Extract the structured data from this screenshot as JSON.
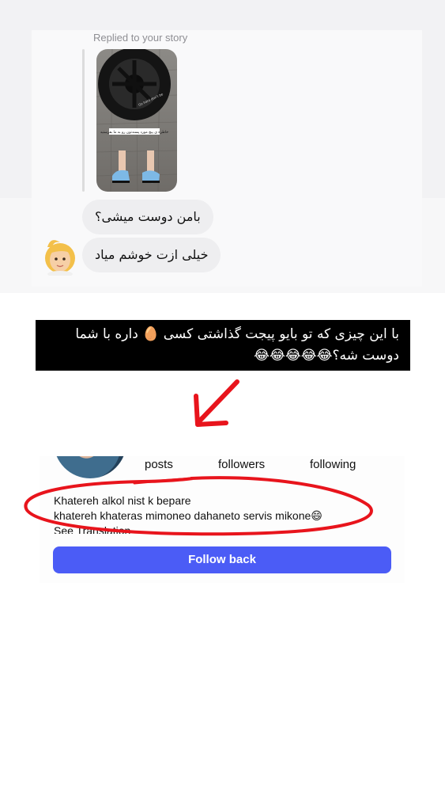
{
  "dm": {
    "replied_label": "Replied to your story",
    "story_caption": "خاطره ی پیچ مورد پسندتون رو به ما بفرستید",
    "story_tire_text": "Go hard don't be",
    "messages": [
      {
        "text": "بامن دوست میشی؟"
      },
      {
        "text": "خیلی ازت خوشم میاد"
      }
    ],
    "avatar_icon": "blonde-girl-emoji"
  },
  "caption": {
    "line1": "با این چیزی که تو بایو پیجت گذاشتی کسی 🥚 داره با شما",
    "line2": "دوست شه؟",
    "emojis": "😂😂😂😂😂"
  },
  "annotation": {
    "color": "#e8141c"
  },
  "profile": {
    "stats": {
      "posts": "posts",
      "followers": "followers",
      "following": "following"
    },
    "bio_line1": "Khatereh alkol nist k bepare",
    "bio_line2": "khatereh khateras mimoneo dahaneto servis mikone😄",
    "see_translation": "See Translation",
    "follow_button": "Follow back",
    "accent": "#4b5cf6"
  }
}
